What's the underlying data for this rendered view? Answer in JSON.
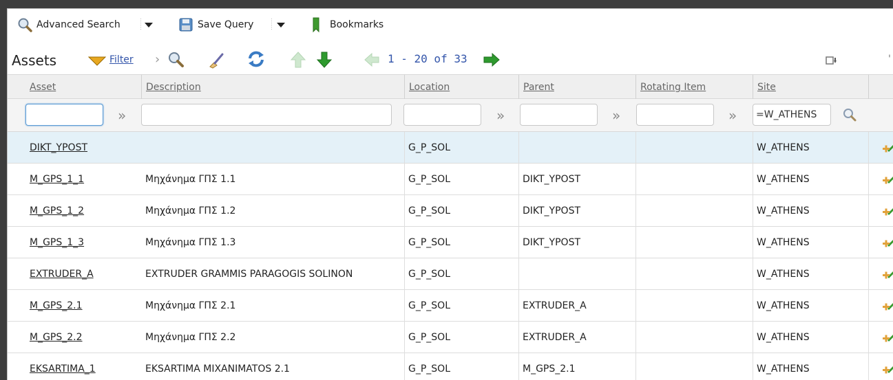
{
  "toolbar": {
    "advanced_search": "Advanced Search",
    "save_query": "Save Query",
    "bookmarks": "Bookmarks"
  },
  "header": {
    "title": "Assets",
    "filter_label": "Filter",
    "pager": "1 - 20 of 33"
  },
  "columns": [
    "Asset",
    "Description",
    "Location",
    "Parent",
    "Rotating Item",
    "Site"
  ],
  "filters": {
    "asset": "",
    "description": "",
    "location": "",
    "parent": "",
    "rotating": "",
    "site": "=W_ATHENS"
  },
  "rows": [
    {
      "asset": "DIKT_YPOST",
      "description": "",
      "location": "G_P_SOL",
      "parent": "",
      "rotating": "",
      "site": "W_ATHENS"
    },
    {
      "asset": "M_GPS_1_1",
      "description": "Μηχάνημα ΓΠΣ 1.1",
      "location": "G_P_SOL",
      "parent": "DIKT_YPOST",
      "rotating": "",
      "site": "W_ATHENS"
    },
    {
      "asset": "M_GPS_1_2",
      "description": "Μηχάνημα ΓΠΣ 1.2",
      "location": "G_P_SOL",
      "parent": "DIKT_YPOST",
      "rotating": "",
      "site": "W_ATHENS"
    },
    {
      "asset": "M_GPS_1_3",
      "description": "Μηχάνημα ΓΠΣ 1.3",
      "location": "G_P_SOL",
      "parent": "DIKT_YPOST",
      "rotating": "",
      "site": "W_ATHENS"
    },
    {
      "asset": "EXTRUDER_A",
      "description": "EXTRUDER GRAMMIS PARAGOGIS SOLINON",
      "location": "G_P_SOL",
      "parent": "",
      "rotating": "",
      "site": "W_ATHENS"
    },
    {
      "asset": "M_GPS_2.1",
      "description": "Μηχάνημα ΓΠΣ 2.1",
      "location": "G_P_SOL",
      "parent": "EXTRUDER_A",
      "rotating": "",
      "site": "W_ATHENS"
    },
    {
      "asset": "M_GPS_2.2",
      "description": "Μηχάνημα ΓΠΣ 2.2",
      "location": "G_P_SOL",
      "parent": "EXTRUDER_A",
      "rotating": "",
      "site": "W_ATHENS"
    },
    {
      "asset": "EKSARTIMA_1",
      "description": "EKSARTIMA MIXANIMATOS 2.1",
      "location": "G_P_SOL",
      "parent": "M_GPS_2.1",
      "rotating": "",
      "site": "W_ATHENS"
    }
  ],
  "colors": {
    "link": "#3355aa",
    "selected_row": "#e4f1f8",
    "green_arrow": "#2e9a2e"
  },
  "icons": [
    "advanced-search-icon",
    "save-query-icon",
    "bookmark-icon",
    "filter-icon",
    "search-icon",
    "clear-icon",
    "refresh-icon",
    "arrow-up-icon",
    "arrow-down-icon",
    "arrow-left-icon",
    "arrow-right-icon",
    "download-icon",
    "add-row-icon"
  ]
}
